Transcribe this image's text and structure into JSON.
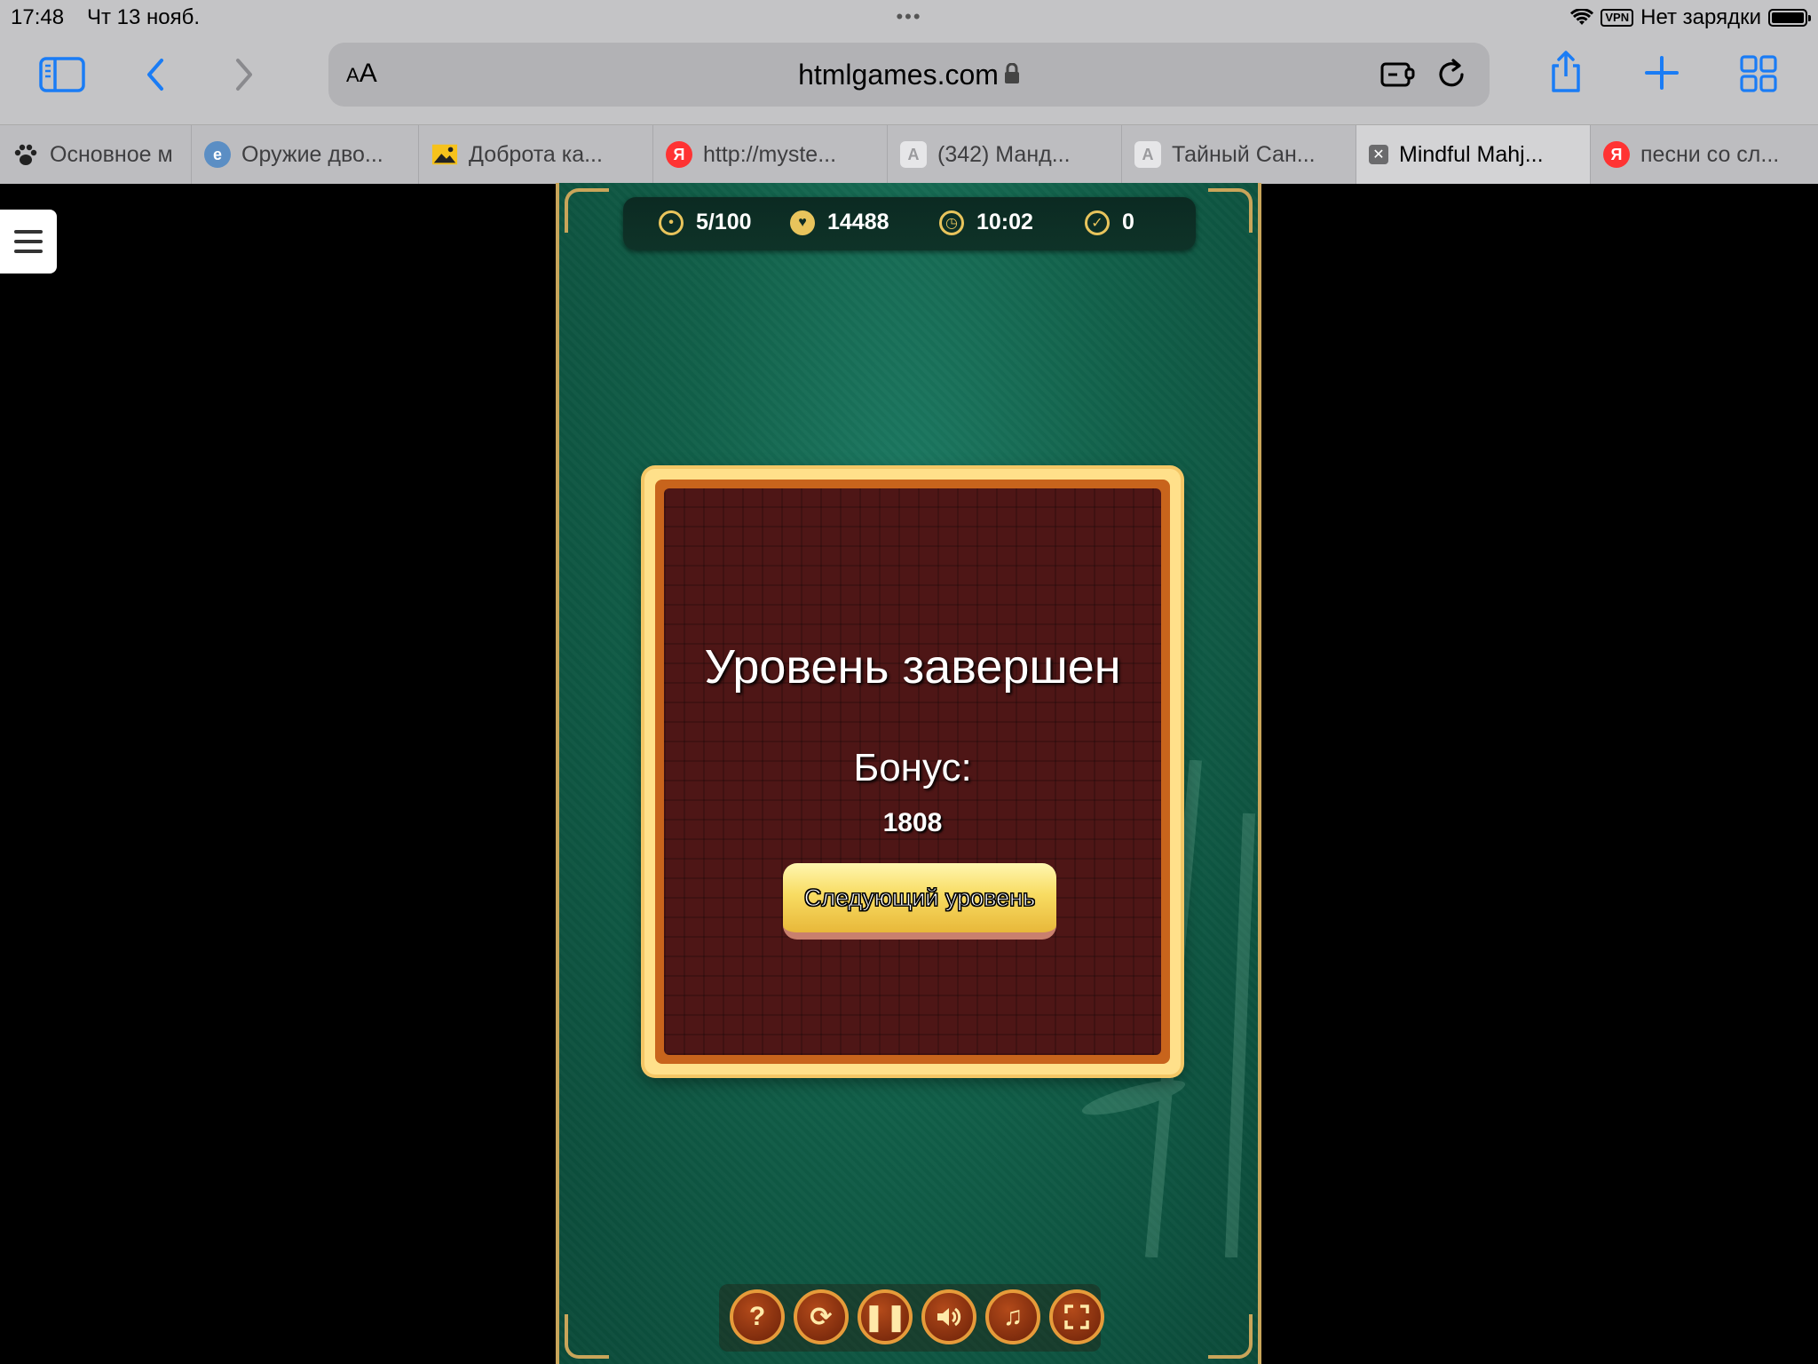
{
  "status": {
    "time": "17:48",
    "date": "Чт 13 нояб.",
    "dots": "•••",
    "vpn": "VPN",
    "charging": "Нет зарядки"
  },
  "toolbar": {
    "text_size": "AA",
    "url": "htmlgames.com"
  },
  "tabs": [
    {
      "label": "Основное м",
      "icon": "paw-icon"
    },
    {
      "label": "Оружие дво...",
      "icon": "site-icon"
    },
    {
      "label": "Доброта ка...",
      "icon": "image-icon"
    },
    {
      "label": "http://myste...",
      "icon": "yandex-icon"
    },
    {
      "label": "(342) Манд...",
      "icon": "a-icon"
    },
    {
      "label": "Тайный Сан...",
      "icon": "a-icon"
    },
    {
      "label": "Mindful Mahj...",
      "icon": "close-icon",
      "active": true
    },
    {
      "label": "песни со сл...",
      "icon": "yandex-icon"
    }
  ],
  "hud": {
    "level": "5/100",
    "score": "14488",
    "time": "10:02",
    "matches": "0"
  },
  "dialog": {
    "title": "Уровень завершен",
    "bonus_label": "Бонус:",
    "bonus_value": "1808",
    "next_button": "Следующий уровень"
  },
  "controls": [
    "help-icon",
    "shuffle-icon",
    "pause-icon",
    "sound-icon",
    "music-icon",
    "fullscreen-icon"
  ],
  "colors": {
    "accent": "#1a7cf5",
    "game_green": "#116049",
    "frame_gold": "#c9a55a",
    "dialog_red": "#4e1616",
    "button_yellow": "#f8dc62"
  }
}
